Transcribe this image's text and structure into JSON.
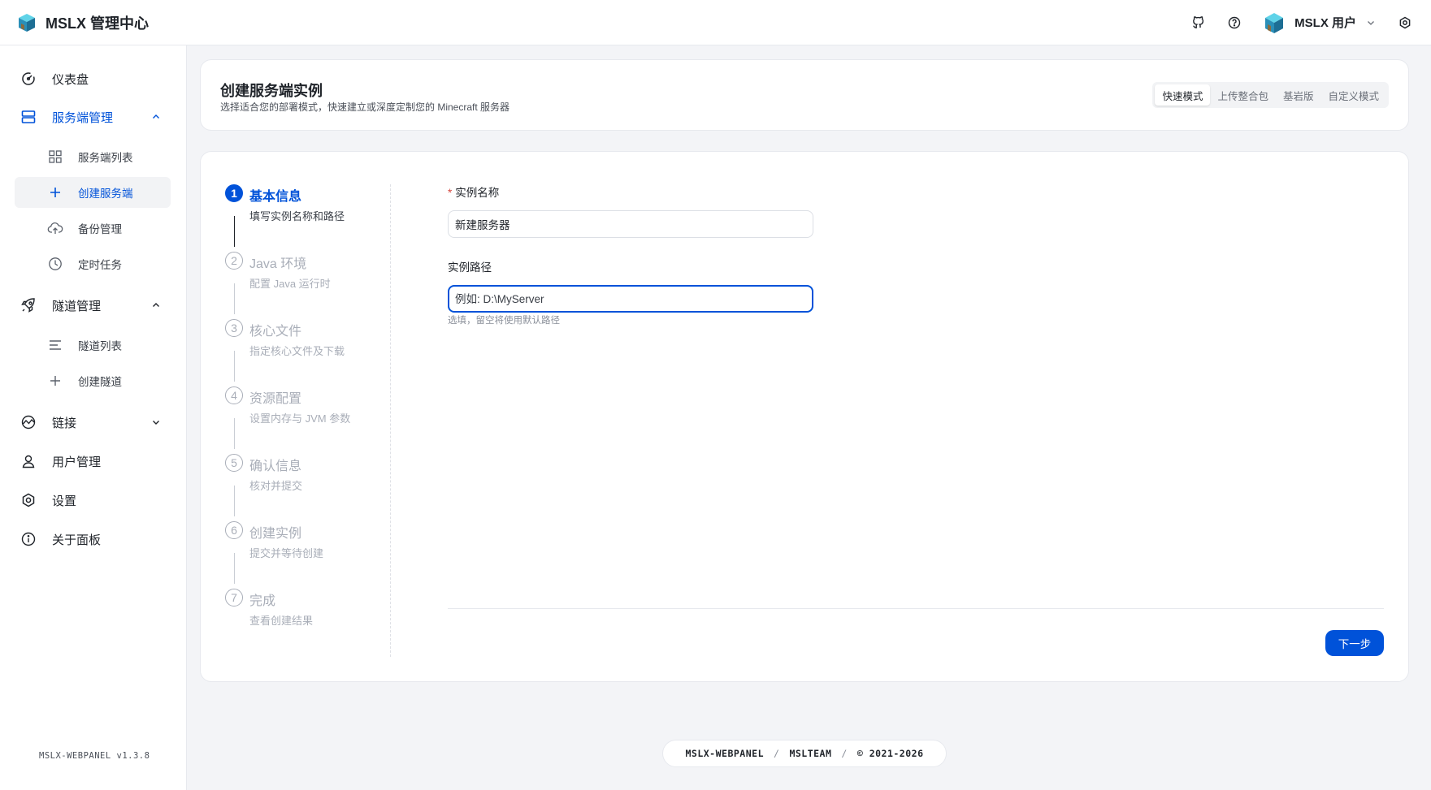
{
  "app": {
    "title": "MSLX 管理中心",
    "version": "MSLX-WEBPANEL v1.3.8"
  },
  "header": {
    "user_name": "MSLX 用户"
  },
  "sidebar": {
    "dashboard": "仪表盘",
    "server_mgmt": "服务端管理",
    "server_list": "服务端列表",
    "create_server": "创建服务端",
    "backup": "备份管理",
    "scheduled": "定时任务",
    "tunnel_mgmt": "隧道管理",
    "tunnel_list": "隧道列表",
    "create_tunnel": "创建隧道",
    "links": "链接",
    "users": "用户管理",
    "settings": "设置",
    "about": "关于面板"
  },
  "page": {
    "title": "创建服务端实例",
    "subtitle": "选择适合您的部署模式，快速建立或深度定制您的 Minecraft 服务器",
    "modes": [
      "快速模式",
      "上传整合包",
      "基岩版",
      "自定义模式"
    ],
    "active_mode": "快速模式"
  },
  "steps": [
    {
      "num": "1",
      "title": "基本信息",
      "desc": "填写实例名称和路径",
      "state": "current"
    },
    {
      "num": "2",
      "title": "Java 环境",
      "desc": "配置 Java 运行时",
      "state": "pending"
    },
    {
      "num": "3",
      "title": "核心文件",
      "desc": "指定核心文件及下载",
      "state": "pending"
    },
    {
      "num": "4",
      "title": "资源配置",
      "desc": "设置内存与 JVM 参数",
      "state": "pending"
    },
    {
      "num": "5",
      "title": "确认信息",
      "desc": "核对并提交",
      "state": "pending"
    },
    {
      "num": "6",
      "title": "创建实例",
      "desc": "提交并等待创建",
      "state": "pending"
    },
    {
      "num": "7",
      "title": "完成",
      "desc": "查看创建结果",
      "state": "pending"
    }
  ],
  "form": {
    "name_label": "实例名称",
    "name_required": "*",
    "name_value": "新建服务器",
    "path_label": "实例路径",
    "path_placeholder": "例如: D:\\MyServer",
    "path_hint": "选填，留空将使用默认路径",
    "next_label": "下一步"
  },
  "footer": {
    "parts": [
      "MSLX-WEBPANEL",
      "MSLTEAM",
      "© 2021-2026"
    ],
    "separator": "/"
  },
  "colors": {
    "primary": "#0052d9",
    "required": "#d54941",
    "background": "#f3f4f7"
  }
}
